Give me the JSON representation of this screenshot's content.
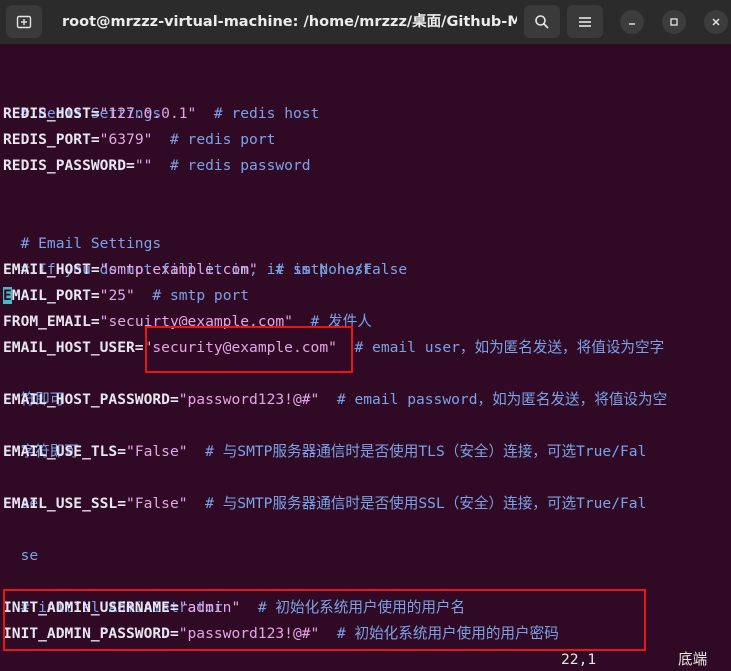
{
  "window": {
    "title": "root@mrzzz-virtual-machine: /home/mrzzz/桌面/Github-Mon..."
  },
  "lines": [
    {
      "comment": "# Redis Settings"
    },
    {
      "key": "REDIS_HOST",
      "eq": "=",
      "value": "\"127.0.0.1\"",
      "comment": "  # redis host"
    },
    {
      "key": "REDIS_PORT",
      "eq": "=",
      "value": "\"6379\"",
      "comment": "  # redis port"
    },
    {
      "key": "REDIS_PASSWORD",
      "eq": "=",
      "value": "\"\"",
      "comment": "  # redis password"
    },
    {
      "comment": "# Email Settings"
    },
    {
      "comment": "# If you do not fill it in, it is None/False"
    },
    {
      "key": "EMAIL_HOST",
      "eq": "=",
      "value": "\"smtp.example.com\"",
      "comment": "  # smtp host"
    },
    {
      "cursor": "E",
      "key": "MAIL_PORT",
      "eq": "=",
      "value": "\"25\"",
      "comment": "  # smtp port"
    },
    {
      "key": "FROM_EMAIL",
      "eq": "=",
      "value": "\"secuirty@example.com\"",
      "comment": "  # 发件人"
    },
    {
      "key": "EMAIL_HOST_USER",
      "eq": "=",
      "value": "\"security@example.com\"",
      "comment": "  # email user，如为匿名发送，将值设为空字"
    },
    {
      "comment": "符即可"
    },
    {
      "key": "EMAIL_HOST_PASSWORD",
      "eq": "=",
      "value": "\"password123!@#\"",
      "comment": "  # email password，如为匿名发送，将值设为空"
    },
    {
      "comment": "字符即可"
    },
    {
      "key": "EMAIL_USE_TLS",
      "eq": "=",
      "value": "\"False\"",
      "comment": "  # 与SMTP服务器通信时是否使用TLS（安全）连接，可选True/Fal"
    },
    {
      "comment": "se"
    },
    {
      "key": "EMAIL_USE_SSL",
      "eq": "=",
      "value": "\"False\"",
      "comment": "  # 与SMTP服务器通信时是否使用SSL（安全）连接，可选True/Fal"
    },
    {
      "comment": "se"
    },
    {
      "comment": "# initial Administrator"
    },
    {
      "key": "INIT_ADMIN_USERNAME",
      "eq": "=",
      "value": "\"admin\"",
      "comment": "  # 初始化系统用户使用的用户名"
    },
    {
      "key": "INIT_ADMIN_PASSWORD",
      "eq": "=",
      "value": "\"password123!@#\"",
      "comment": "  # 初始化系统用户使用的用户密码"
    }
  ],
  "status": {
    "position": "22,1",
    "scroll": "底端"
  },
  "colors": {
    "background": "#300a24",
    "comment": "#7ba2e9",
    "string": "#e3a5e5",
    "key": "#e6e6f0",
    "cursor": "#48b9c7",
    "highlight_box": "#e8161b"
  }
}
